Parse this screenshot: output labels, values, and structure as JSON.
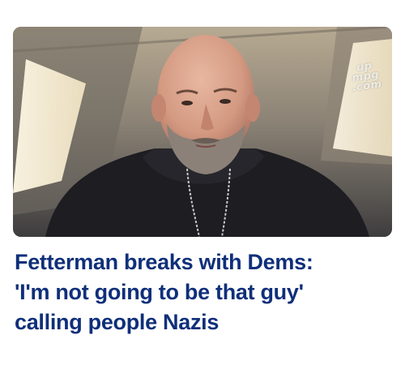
{
  "article": {
    "headline_lines": [
      "Fetterman breaks with Dems:",
      "'I'm not going to be that guy'",
      "calling people Nazis"
    ],
    "photo": {
      "alt_subject": "portrait of man in black hoodie",
      "watermark": [
        "up",
        "mpg",
        ".com"
      ]
    }
  },
  "colors": {
    "headline": "#0f2f7a",
    "background": "#ffffff"
  }
}
